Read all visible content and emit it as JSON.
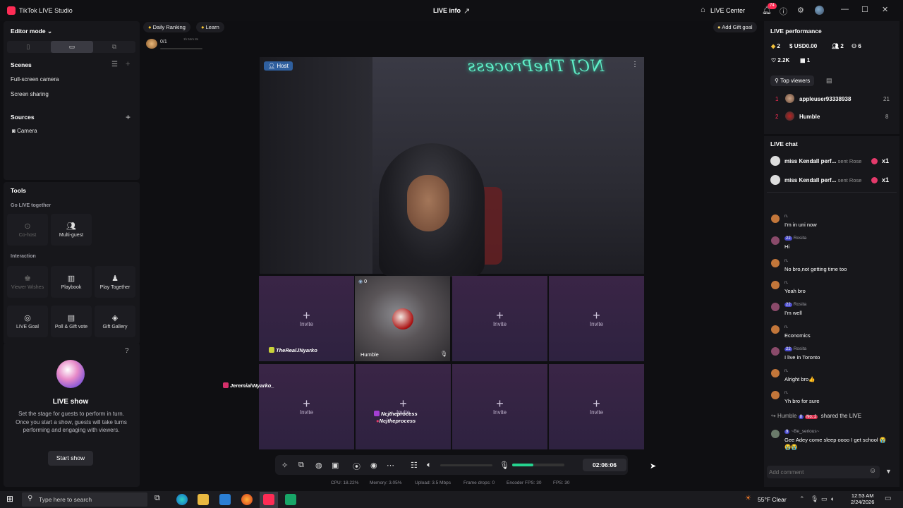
{
  "titlebar": {
    "app_name": "TikTok LIVE Studio",
    "center_title": "LIVE info",
    "live_center": "LIVE Center",
    "notif_count": "74"
  },
  "left": {
    "editor_mode": "Editor mode",
    "scenes_title": "Scenes",
    "scenes": [
      "Full-screen camera",
      "Screen sharing"
    ],
    "sources_title": "Sources",
    "sources": [
      "Camera"
    ],
    "tools_title": "Tools",
    "go_live_together": "Go LIVE together",
    "cohost": "Co-host",
    "multiguest": "Multi-guest",
    "interaction": "Interaction",
    "viewer_wishes": "Viewer Wishes",
    "playbook": "Playbook",
    "play_together": "Play Together",
    "live_goal": "LIVE Goal",
    "poll_gift_vote": "Poll & Gift vote",
    "gift_gallery": "Gift Gallery",
    "live_show_title": "LIVE show",
    "live_show_desc": "Set the stage for guests to perform in turn. Once you start a show, guests will take turns performing and engaging with viewers.",
    "start_show": "Start show"
  },
  "top": {
    "daily_ranking": "Daily Ranking",
    "learn": "Learn",
    "progress": "0/1",
    "timer": "1h 54m 8s",
    "add_gift_goal": "Add Gift goal"
  },
  "stage": {
    "host_label": "Host",
    "neon_text": "NCJ TheProcess"
  },
  "grid": {
    "invite": "Invite",
    "guest_name": "Humble",
    "guest_count": "0",
    "names": [
      "TheRealJNyarko",
      "JeremiahNyarko_",
      "Ncjtheprocess",
      "Ncjtheprocess"
    ]
  },
  "controls": {
    "timer": "02:06:06",
    "mic_level": 0.4
  },
  "stats": {
    "cpu": "CPU: 18.22%",
    "memory": "Memory: 3.05%",
    "upload": "Upload: 3.5 Mbps",
    "frame_drops": "Frame drops: 0",
    "encoder_fps": "Encoder FPS: 30",
    "fps": "FPS: 30"
  },
  "performance": {
    "title": "LIVE performance",
    "diamonds": "2",
    "usd": "USD0.00",
    "viewers": "2",
    "new_followers": "6",
    "likes": "2.2K",
    "gifts": "1",
    "top_viewers_tab": "Top viewers",
    "top_viewers": [
      {
        "rank": "1",
        "name": "appleuser93338938",
        "score": "21"
      },
      {
        "rank": "2",
        "name": "Humble",
        "score": "8"
      }
    ]
  },
  "chat": {
    "title": "LIVE chat",
    "gifts": [
      {
        "name": "miss Kendall perf...",
        "action": "sent Rose",
        "count": "x1"
      },
      {
        "name": "miss Kendall perf...",
        "action": "sent Rose",
        "count": "x1"
      }
    ],
    "messages": [
      {
        "user": "n.",
        "level": "",
        "text": "I'm in uni now"
      },
      {
        "user": "Rosita",
        "level": "22",
        "text": "Hi"
      },
      {
        "user": "n.",
        "level": "",
        "text": "No bro,not getting time too"
      },
      {
        "user": "n.",
        "level": "",
        "text": "Yeah bro"
      },
      {
        "user": "Rosita",
        "level": "22",
        "text": "I'm well"
      },
      {
        "user": "n.",
        "level": "",
        "text": "Economics"
      },
      {
        "user": "Rosita",
        "level": "22",
        "text": "I live in Toronto"
      },
      {
        "user": "n.",
        "level": "",
        "text": "Alright bro👍"
      },
      {
        "user": "n.",
        "level": "",
        "text": "Yh bro for sure"
      }
    ],
    "share": {
      "user": "Humble",
      "level": "8",
      "badge": "No. 2",
      "text": "shared the LIVE"
    },
    "last": {
      "user": "~Be_serious~",
      "level": "9",
      "text": "Gee Adey come sleep oooo I get school 😭😭😭"
    },
    "placeholder": "Add comment"
  },
  "taskbar": {
    "search": "Type here to search",
    "weather": "55°F Clear",
    "time": "12:53 AM",
    "date": "2/24/2026"
  }
}
